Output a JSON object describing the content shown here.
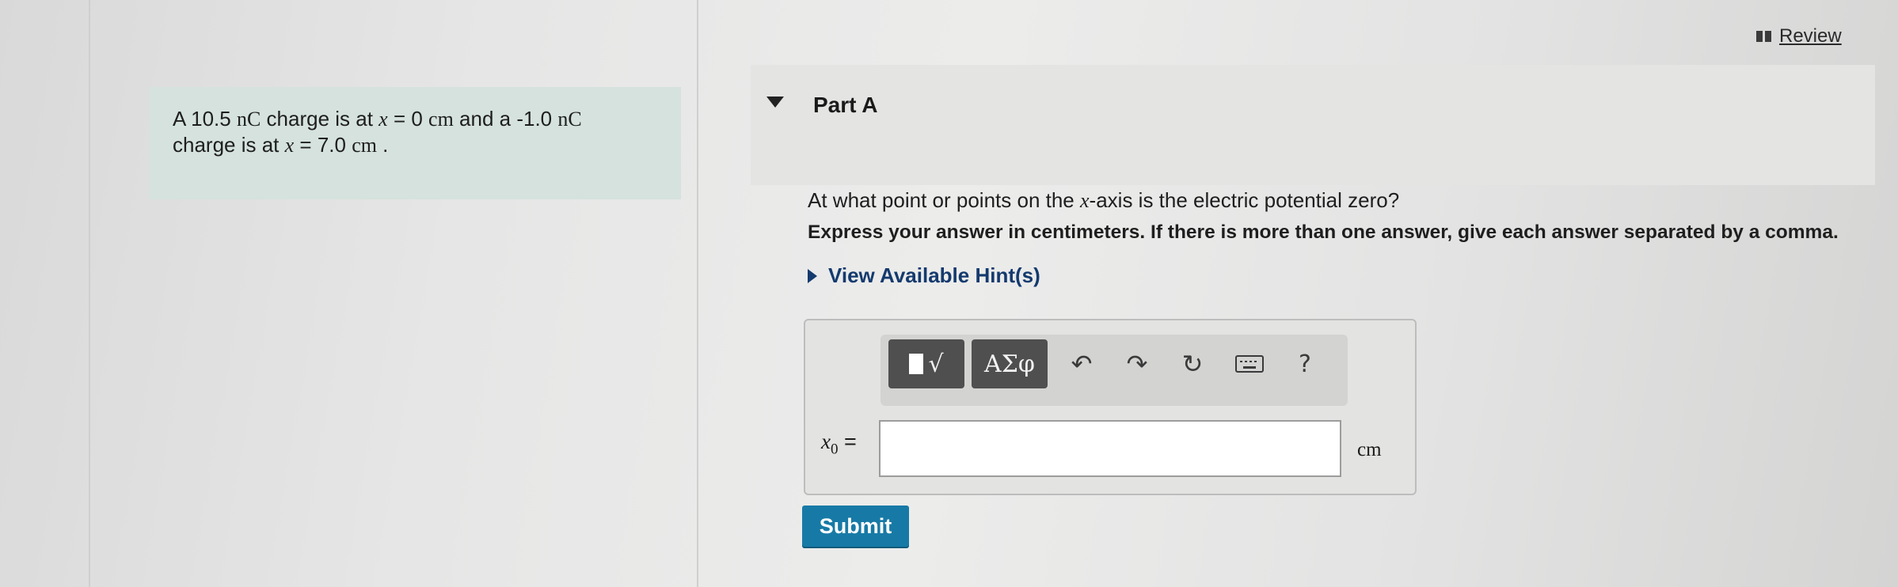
{
  "review": {
    "label": "Review"
  },
  "problem": {
    "line1": {
      "pre": "A 10.5 ",
      "unit1": "nC",
      "mid": " charge is at ",
      "var": "x",
      "eq": " = 0 ",
      "unit2": "cm",
      "post": " and a -1.0 ",
      "unit3": "nC"
    },
    "line2": {
      "pre": "charge is at ",
      "var": "x",
      "eq": " = 7.0 ",
      "unit": "cm",
      "post": " ."
    }
  },
  "part": {
    "title": "Part A"
  },
  "question": {
    "pre": "At what point or points on the ",
    "var": "x",
    "post": "-axis is the electric potential zero?"
  },
  "instruction": "Express your answer in centimeters. If there is more than one answer, give each answer separated by a comma.",
  "hint": {
    "label": "View Available Hint(s)"
  },
  "toolbar": {
    "templates_glyph": "√",
    "greek_label": "ΑΣφ",
    "undo_glyph": "↶",
    "redo_glyph": "↷",
    "reset_glyph": "↻",
    "help_label": "?"
  },
  "answer": {
    "var": "x",
    "sub": "0",
    "eq": " =",
    "value": "",
    "unit": "cm"
  },
  "submit": {
    "label": "Submit"
  },
  "colors": {
    "accent": "#177aa6",
    "hint": "#143a6e",
    "problem_bg": "#d5e2dd"
  }
}
